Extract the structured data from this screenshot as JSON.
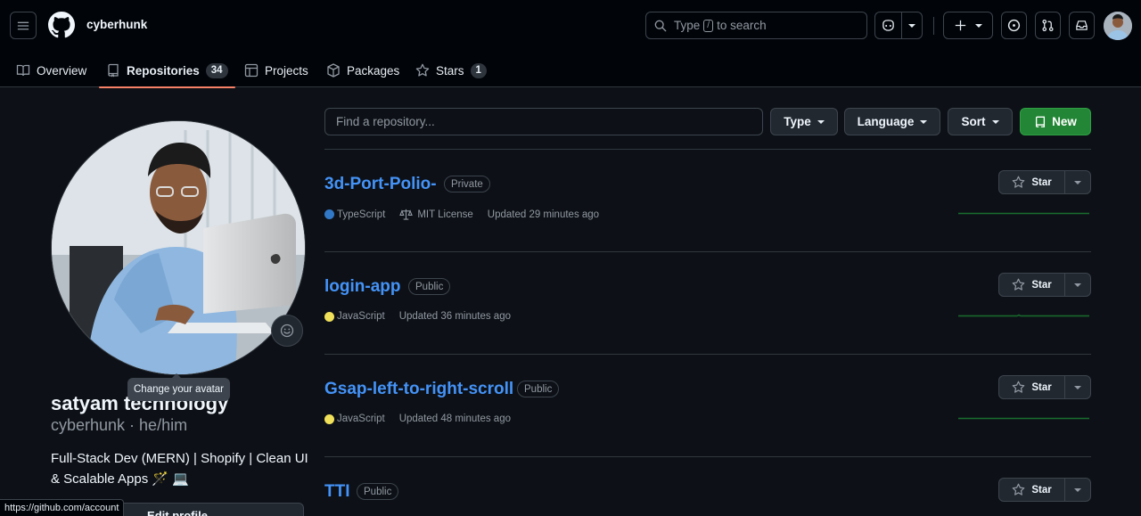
{
  "header": {
    "owner": "cyberhunk",
    "search": {
      "prefix": "Type",
      "key": "/",
      "suffix": "to search"
    }
  },
  "tabs": [
    {
      "label": "Overview"
    },
    {
      "label": "Repositories",
      "count": "34"
    },
    {
      "label": "Projects"
    },
    {
      "label": "Packages"
    },
    {
      "label": "Stars",
      "count": "1"
    }
  ],
  "profile": {
    "tooltip": "Change your avatar",
    "name": "satyam technology",
    "login": "cyberhunk · he/him",
    "bio_line1": "Full-Stack Dev (MERN) | Shopify | Clean UI",
    "bio_line2": "& Scalable Apps 🪄 💻",
    "edit_button": "Edit profile",
    "status_url": "https://github.com/account"
  },
  "filters": {
    "find_placeholder": "Find a repository...",
    "type": "Type",
    "language": "Language",
    "sort": "Sort",
    "new": "New"
  },
  "colors": {
    "accent_link": "#4493f8",
    "new_button": "#238636",
    "typescript": "#3178c6",
    "javascript": "#f1e05a",
    "tab_underline": "#f78166"
  },
  "repos": [
    {
      "name": "3d-Port-Polio-",
      "visibility": "Private",
      "language": "TypeScript",
      "license": "MIT License",
      "updated": "Updated 29 minutes ago",
      "star": "Star"
    },
    {
      "name": "login-app",
      "visibility": "Public",
      "language": "JavaScript",
      "updated": "Updated 36 minutes ago",
      "star": "Star"
    },
    {
      "name": "Gsap-left-to-right-scroll",
      "visibility": "Public",
      "language": "JavaScript",
      "updated": "Updated 48 minutes ago",
      "star": "Star"
    },
    {
      "name": "TTI",
      "visibility": "Public",
      "star": "Star"
    }
  ]
}
